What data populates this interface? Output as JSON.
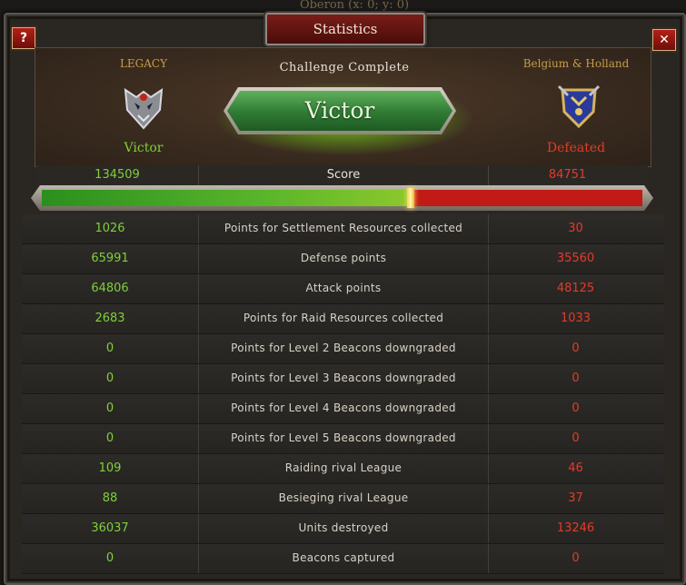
{
  "background": {
    "title": "Oberon (x: 0; y: 0)"
  },
  "dialog": {
    "title": "Statistics",
    "help_label": "?",
    "close_label": "✕"
  },
  "header": {
    "left_team": {
      "name": "LEGACY",
      "status": "Victor",
      "emblem_icon": "wolf-crest-icon"
    },
    "right_team": {
      "name": "Belgium & Holland",
      "status": "Defeated",
      "emblem_icon": "blue-shield-crest-icon"
    },
    "challenge_text": "Challenge Complete",
    "result_banner": "Victor"
  },
  "score": {
    "left": "134509",
    "label": "Score",
    "right": "84751",
    "left_share": 0.6135
  },
  "stats": [
    {
      "left": "1026",
      "label": "Points for Settlement Resources collected",
      "right": "30"
    },
    {
      "left": "65991",
      "label": "Defense points",
      "right": "35560"
    },
    {
      "left": "64806",
      "label": "Attack points",
      "right": "48125"
    },
    {
      "left": "2683",
      "label": "Points for Raid Resources collected",
      "right": "1033"
    },
    {
      "left": "0",
      "label": "Points for Level 2 Beacons downgraded",
      "right": "0"
    },
    {
      "left": "0",
      "label": "Points for Level 3 Beacons downgraded",
      "right": "0"
    },
    {
      "left": "0",
      "label": "Points for Level 4 Beacons downgraded",
      "right": "0"
    },
    {
      "left": "0",
      "label": "Points for Level 5 Beacons downgraded",
      "right": "0"
    },
    {
      "left": "109",
      "label": "Raiding rival League",
      "right": "46"
    },
    {
      "left": "88",
      "label": "Besieging rival League",
      "right": "37"
    },
    {
      "left": "36037",
      "label": "Units destroyed",
      "right": "13246"
    },
    {
      "left": "0",
      "label": "Beacons captured",
      "right": "0"
    }
  ],
  "colors": {
    "victor": "#7fcf3a",
    "defeated": "#e23b2a",
    "accent_gold": "#c89c48"
  }
}
